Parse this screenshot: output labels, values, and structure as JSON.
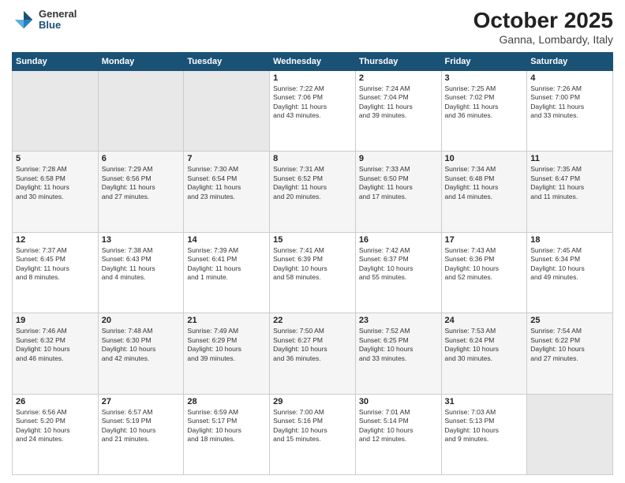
{
  "header": {
    "logo_general": "General",
    "logo_blue": "Blue",
    "title": "October 2025",
    "subtitle": "Ganna, Lombardy, Italy"
  },
  "days_of_week": [
    "Sunday",
    "Monday",
    "Tuesday",
    "Wednesday",
    "Thursday",
    "Friday",
    "Saturday"
  ],
  "weeks": [
    [
      {
        "day": "",
        "info": ""
      },
      {
        "day": "",
        "info": ""
      },
      {
        "day": "",
        "info": ""
      },
      {
        "day": "1",
        "info": "Sunrise: 7:22 AM\nSunset: 7:06 PM\nDaylight: 11 hours\nand 43 minutes."
      },
      {
        "day": "2",
        "info": "Sunrise: 7:24 AM\nSunset: 7:04 PM\nDaylight: 11 hours\nand 39 minutes."
      },
      {
        "day": "3",
        "info": "Sunrise: 7:25 AM\nSunset: 7:02 PM\nDaylight: 11 hours\nand 36 minutes."
      },
      {
        "day": "4",
        "info": "Sunrise: 7:26 AM\nSunset: 7:00 PM\nDaylight: 11 hours\nand 33 minutes."
      }
    ],
    [
      {
        "day": "5",
        "info": "Sunrise: 7:28 AM\nSunset: 6:58 PM\nDaylight: 11 hours\nand 30 minutes."
      },
      {
        "day": "6",
        "info": "Sunrise: 7:29 AM\nSunset: 6:56 PM\nDaylight: 11 hours\nand 27 minutes."
      },
      {
        "day": "7",
        "info": "Sunrise: 7:30 AM\nSunset: 6:54 PM\nDaylight: 11 hours\nand 23 minutes."
      },
      {
        "day": "8",
        "info": "Sunrise: 7:31 AM\nSunset: 6:52 PM\nDaylight: 11 hours\nand 20 minutes."
      },
      {
        "day": "9",
        "info": "Sunrise: 7:33 AM\nSunset: 6:50 PM\nDaylight: 11 hours\nand 17 minutes."
      },
      {
        "day": "10",
        "info": "Sunrise: 7:34 AM\nSunset: 6:48 PM\nDaylight: 11 hours\nand 14 minutes."
      },
      {
        "day": "11",
        "info": "Sunrise: 7:35 AM\nSunset: 6:47 PM\nDaylight: 11 hours\nand 11 minutes."
      }
    ],
    [
      {
        "day": "12",
        "info": "Sunrise: 7:37 AM\nSunset: 6:45 PM\nDaylight: 11 hours\nand 8 minutes."
      },
      {
        "day": "13",
        "info": "Sunrise: 7:38 AM\nSunset: 6:43 PM\nDaylight: 11 hours\nand 4 minutes."
      },
      {
        "day": "14",
        "info": "Sunrise: 7:39 AM\nSunset: 6:41 PM\nDaylight: 11 hours\nand 1 minute."
      },
      {
        "day": "15",
        "info": "Sunrise: 7:41 AM\nSunset: 6:39 PM\nDaylight: 10 hours\nand 58 minutes."
      },
      {
        "day": "16",
        "info": "Sunrise: 7:42 AM\nSunset: 6:37 PM\nDaylight: 10 hours\nand 55 minutes."
      },
      {
        "day": "17",
        "info": "Sunrise: 7:43 AM\nSunset: 6:36 PM\nDaylight: 10 hours\nand 52 minutes."
      },
      {
        "day": "18",
        "info": "Sunrise: 7:45 AM\nSunset: 6:34 PM\nDaylight: 10 hours\nand 49 minutes."
      }
    ],
    [
      {
        "day": "19",
        "info": "Sunrise: 7:46 AM\nSunset: 6:32 PM\nDaylight: 10 hours\nand 46 minutes."
      },
      {
        "day": "20",
        "info": "Sunrise: 7:48 AM\nSunset: 6:30 PM\nDaylight: 10 hours\nand 42 minutes."
      },
      {
        "day": "21",
        "info": "Sunrise: 7:49 AM\nSunset: 6:29 PM\nDaylight: 10 hours\nand 39 minutes."
      },
      {
        "day": "22",
        "info": "Sunrise: 7:50 AM\nSunset: 6:27 PM\nDaylight: 10 hours\nand 36 minutes."
      },
      {
        "day": "23",
        "info": "Sunrise: 7:52 AM\nSunset: 6:25 PM\nDaylight: 10 hours\nand 33 minutes."
      },
      {
        "day": "24",
        "info": "Sunrise: 7:53 AM\nSunset: 6:24 PM\nDaylight: 10 hours\nand 30 minutes."
      },
      {
        "day": "25",
        "info": "Sunrise: 7:54 AM\nSunset: 6:22 PM\nDaylight: 10 hours\nand 27 minutes."
      }
    ],
    [
      {
        "day": "26",
        "info": "Sunrise: 6:56 AM\nSunset: 5:20 PM\nDaylight: 10 hours\nand 24 minutes."
      },
      {
        "day": "27",
        "info": "Sunrise: 6:57 AM\nSunset: 5:19 PM\nDaylight: 10 hours\nand 21 minutes."
      },
      {
        "day": "28",
        "info": "Sunrise: 6:59 AM\nSunset: 5:17 PM\nDaylight: 10 hours\nand 18 minutes."
      },
      {
        "day": "29",
        "info": "Sunrise: 7:00 AM\nSunset: 5:16 PM\nDaylight: 10 hours\nand 15 minutes."
      },
      {
        "day": "30",
        "info": "Sunrise: 7:01 AM\nSunset: 5:14 PM\nDaylight: 10 hours\nand 12 minutes."
      },
      {
        "day": "31",
        "info": "Sunrise: 7:03 AM\nSunset: 5:13 PM\nDaylight: 10 hours\nand 9 minutes."
      },
      {
        "day": "",
        "info": ""
      }
    ]
  ]
}
